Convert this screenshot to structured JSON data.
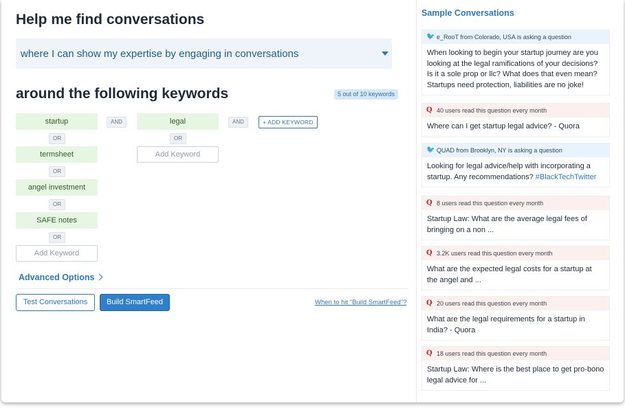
{
  "header": {
    "title": "Help me find conversations"
  },
  "search_select": {
    "value": "where I can show my expertise by engaging in conversations"
  },
  "keywords_section": {
    "title": "around the following keywords",
    "count_badge": "5 out of 10 keywords",
    "add_keyword_button": "+ ADD KEYWORD",
    "and_label": "AND",
    "or_label": "OR",
    "add_keyword_placeholder": "Add Keyword",
    "group1": [
      "startup",
      "termsheet",
      "angel investment",
      "SAFE notes"
    ],
    "group2": [
      "legal"
    ]
  },
  "advanced_options": "Advanced Options",
  "actions": {
    "test_label": "Test Conversations",
    "build_label": "Build SmartFeed",
    "help_link": "When to hit \"Build SmartFeed\"?"
  },
  "sidebar": {
    "title": "Sample Conversations",
    "cards": [
      {
        "source": "twitter",
        "header": "e_RooT from Colorado, USA is asking a question",
        "text": "When looking to begin your startup journey are you looking at the legal ramifications of your decisions? Is it a sole prop or llc? What does that even mean? Startups need protection, liabilities are no joke!"
      },
      {
        "source": "quora",
        "header": "40 users read this question every month",
        "text": "Where can I get startup legal advice? - Quora"
      },
      {
        "source": "twitter",
        "header": "QUAD from Brooklyn, NY is asking a question",
        "text": "Looking for legal advice/help with incorporating a startup. Any recommendations?",
        "hashtag": "#BlackTechTwitter"
      },
      {
        "source": "quora",
        "header": "8 users read this question every month",
        "text": "Startup Law: What are the average legal fees of bringing on a non ..."
      },
      {
        "source": "quora",
        "header": "3.2K users read this question every month",
        "text": "What are the expected legal costs for a startup at the angel and ..."
      },
      {
        "source": "quora",
        "header": "20 users read this question every month",
        "text": "What are the legal requirements for a startup in India? - Quora"
      },
      {
        "source": "quora",
        "header": "18 users read this question every month",
        "text": "Startup Law: Where is the best place to get pro-bono legal advice for ..."
      }
    ]
  },
  "icons": {
    "twitter": "twitter-bird-icon",
    "quora": "quora-q-icon",
    "select_caret": "caret-down-icon",
    "advanced_chevron": "chevron-right-icon"
  },
  "colors": {
    "accent": "#2a79bf",
    "primary_button": "#2f7fcc",
    "keyword_bg": "#e7f6e2",
    "twitter_header": "#e8f3fd",
    "quora_header": "#fcf0ee"
  }
}
